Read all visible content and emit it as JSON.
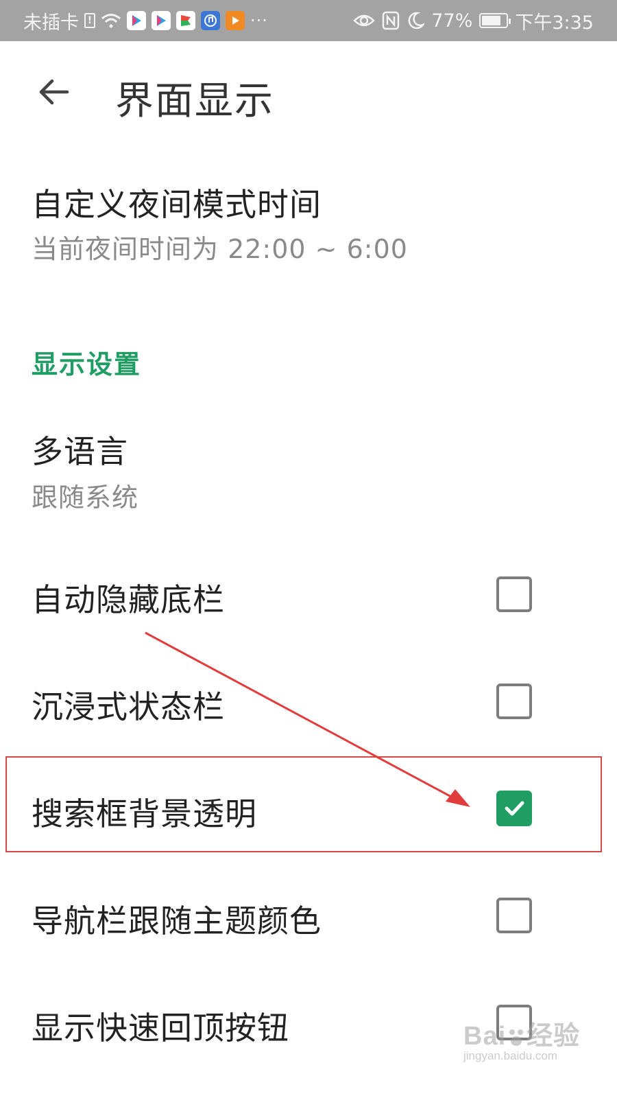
{
  "status_bar": {
    "carrier": "未插卡",
    "sim_indicator": "!",
    "notification_apps": [
      "youku",
      "youku",
      "flag-app",
      "music-app",
      "video-player-app"
    ],
    "more": "···",
    "battery": "77%",
    "battery_level": 0.77,
    "time": "下午3:35",
    "icons": [
      "eye-icon",
      "nfc-icon",
      "moon-icon",
      "battery-icon"
    ]
  },
  "header": {
    "title": "界面显示",
    "back_icon": "back-arrow-icon"
  },
  "night_mode": {
    "title": "自定义夜间模式时间",
    "subtitle": "当前夜间时间为 22:00 ~ 6:00"
  },
  "display_section": {
    "title": "显示设置",
    "language": {
      "title": "多语言",
      "subtitle": "跟随系统"
    },
    "options": [
      {
        "label": "自动隐藏底栏",
        "checked": false
      },
      {
        "label": "沉浸式状态栏",
        "checked": false
      },
      {
        "label": "搜索框背景透明",
        "checked": true
      },
      {
        "label": "导航栏跟随主题颜色",
        "checked": false
      },
      {
        "label": "显示快速回顶按钮",
        "checked": false
      }
    ]
  },
  "annotation": {
    "highlighted_option": "搜索框背景透明",
    "color": "#d94848"
  },
  "watermark": {
    "main": "Bai",
    "brand_chars": "经验",
    "url": "jingyan.baidu.com"
  },
  "colors": {
    "accent": "#1f9d63",
    "status_bar_bg": "#a3a3a3"
  }
}
